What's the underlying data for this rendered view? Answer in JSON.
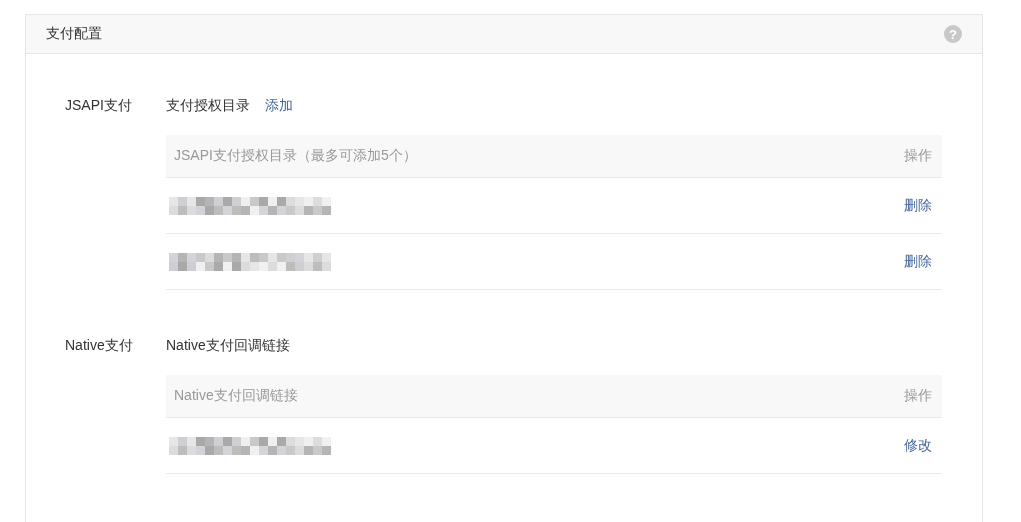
{
  "panel": {
    "title": "支付配置",
    "help_icon": "?"
  },
  "sections": [
    {
      "label": "JSAPI支付",
      "heading": "支付授权目录",
      "heading_link": "添加",
      "table": {
        "columns": [
          "JSAPI支付授权目录（最多可添加5个）",
          "操作"
        ],
        "rows": [
          {
            "address": {
              "kind": "redacted"
            },
            "action": "删除"
          },
          {
            "address": {
              "kind": "redacted"
            },
            "action": "删除"
          }
        ]
      }
    },
    {
      "label": "Native支付",
      "heading": "Native支付回调链接",
      "table": {
        "columns": [
          "Native支付回调链接",
          "操作"
        ],
        "rows": [
          {
            "address": {
              "kind": "redacted"
            },
            "action": "修改"
          }
        ]
      }
    }
  ]
}
